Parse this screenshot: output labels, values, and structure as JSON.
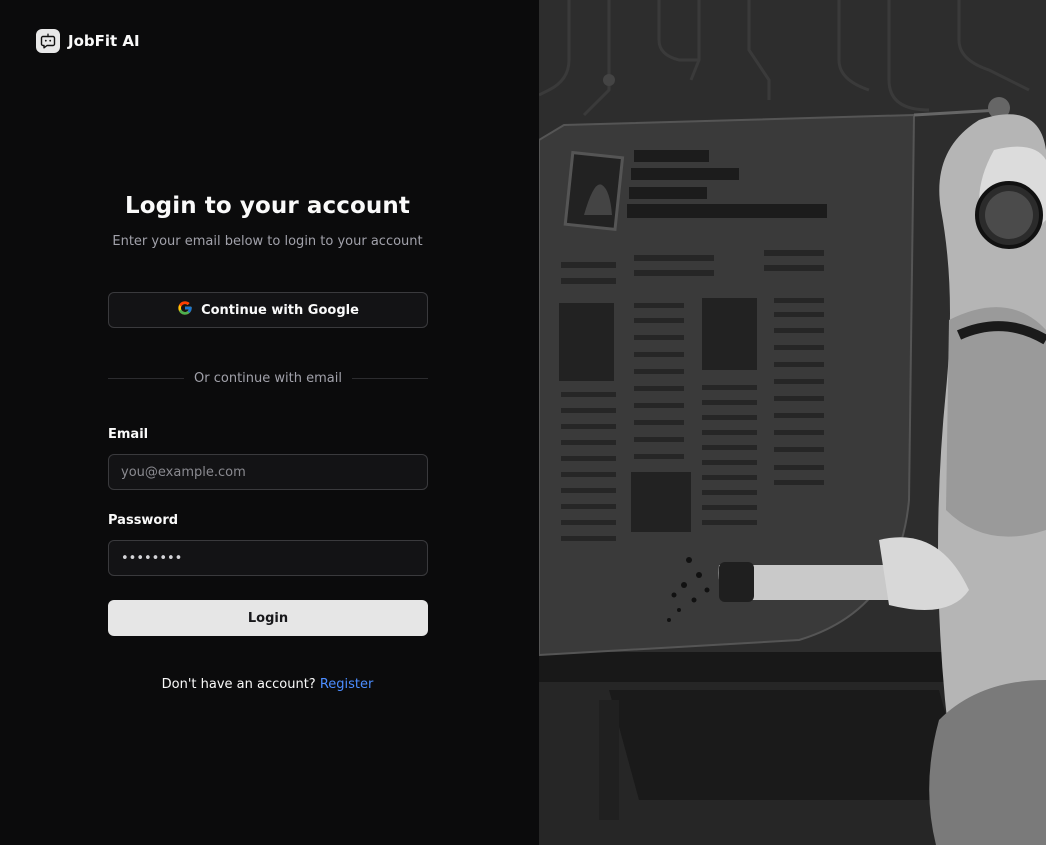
{
  "brand": {
    "name": "JobFit AI",
    "icon": "bot-chat-icon"
  },
  "login": {
    "title": "Login to your account",
    "subtitle": "Enter your email below to login to your account",
    "google_button": "Continue with Google",
    "divider_text": "Or continue with email",
    "email_label": "Email",
    "email_placeholder": "you@example.com",
    "email_value": "",
    "password_label": "Password",
    "password_value": "••••••••",
    "login_button": "Login",
    "footer_text": "Don't have an account?",
    "register_link": "Register"
  },
  "colors": {
    "background": "#0b0b0c",
    "accent_link": "#4c8dff",
    "button_primary": "#e6e6e6",
    "border": "#3a3a3d"
  },
  "illustration": {
    "icon": "robot-reading-resume-illustration"
  }
}
